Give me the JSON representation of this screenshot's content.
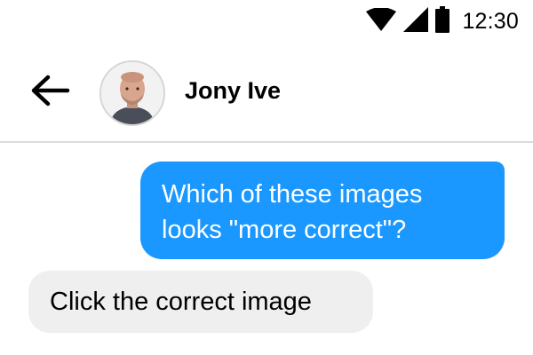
{
  "status_bar": {
    "time": "12:30",
    "icons": [
      "wifi-icon",
      "cellular-signal-icon",
      "battery-icon"
    ]
  },
  "header": {
    "back_icon": "arrow-left-icon",
    "contact_name": "Jony Ive",
    "avatar": "contact-avatar-photo"
  },
  "messages": [
    {
      "direction": "outgoing",
      "text": "Which of these images looks \"more correct\"?"
    },
    {
      "direction": "incoming",
      "text": "Click the correct image"
    }
  ],
  "colors": {
    "outgoing_bubble": "#1a98ff",
    "incoming_bubble": "#efefef",
    "divider": "#dcdcdc"
  }
}
